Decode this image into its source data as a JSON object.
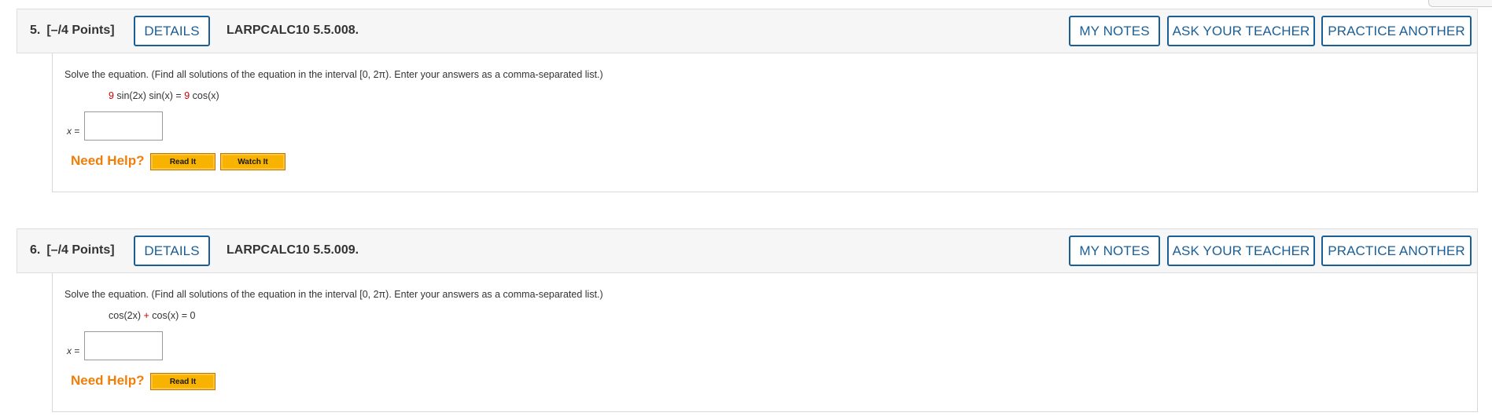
{
  "questions": [
    {
      "number": "5.",
      "points": "[–/4 Points]",
      "details_label": "DETAILS",
      "code": "LARPCALC10 5.5.008.",
      "my_notes_label": "MY NOTES",
      "ask_teacher_label": "ASK YOUR TEACHER",
      "practice_label": "PRACTICE ANOTHER",
      "prompt": "Solve the equation. (Find all solutions of the equation in the interval [0, 2π). Enter your answers as a comma-separated list.)",
      "equation": {
        "coef1": "9",
        "part1": " sin(2x) sin(x) = ",
        "coef2": "9",
        "part2": " cos(x)"
      },
      "answer_label": "x",
      "answer_eq": " =",
      "answer_value": "",
      "need_help": "Need Help?",
      "read_it": "Read It",
      "watch_it": "Watch It"
    },
    {
      "number": "6.",
      "points": "[–/4 Points]",
      "details_label": "DETAILS",
      "code": "LARPCALC10 5.5.009.",
      "my_notes_label": "MY NOTES",
      "ask_teacher_label": "ASK YOUR TEACHER",
      "practice_label": "PRACTICE ANOTHER",
      "prompt": "Solve the equation. (Find all solutions of the equation in the interval [0, 2π). Enter your answers as a comma-separated list.)",
      "equation": {
        "part1": "cos(2x) ",
        "op": "+",
        "part2": " cos(x) = 0"
      },
      "answer_label": "x",
      "answer_eq": " =",
      "answer_value": "",
      "need_help": "Need Help?",
      "read_it": "Read It"
    }
  ],
  "colors": {
    "accent_blue": "#1a5e96",
    "help_orange": "#f07f09",
    "button_gold": "#f8b200",
    "coef_red": "#cc0000"
  }
}
